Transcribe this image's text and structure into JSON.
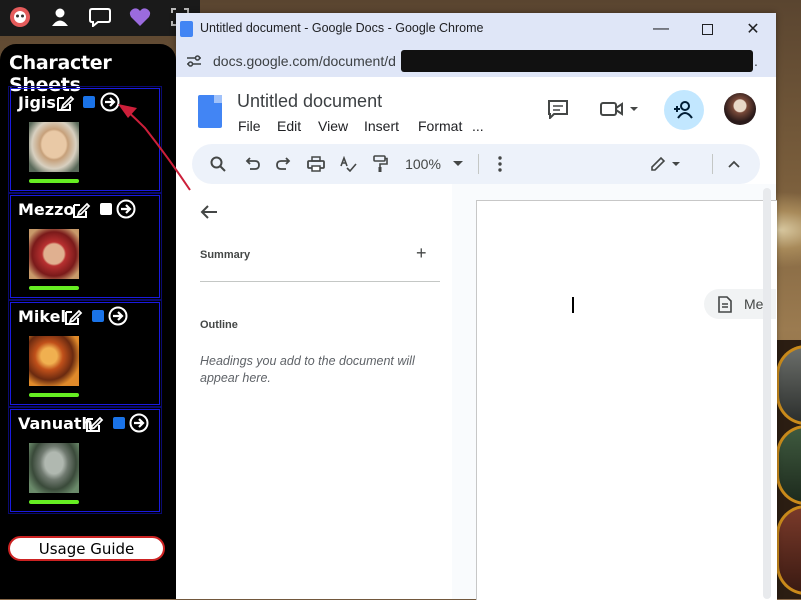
{
  "top_bar": {
    "icons": [
      "helmet-icon",
      "person-icon",
      "chat-icon",
      "heart-icon",
      "camera-icon"
    ]
  },
  "sidebar": {
    "title": "Character Sheets",
    "characters": [
      {
        "name": "Jigis",
        "checked": true,
        "hp_fraction": 1.0
      },
      {
        "name": "Mezzo",
        "checked": false,
        "hp_fraction": 1.0
      },
      {
        "name": "Mikel",
        "checked": true,
        "hp_fraction": 1.0
      },
      {
        "name": "Vanuath",
        "checked": true,
        "hp_fraction": 1.0
      }
    ],
    "usage_guide_label": "Usage Guide"
  },
  "browser": {
    "window_title": "Untitled document - Google Docs - Google Chrome",
    "url": "docs.google.com/document/d",
    "url_tail": "."
  },
  "docs": {
    "doc_title": "Untitled document",
    "menu": [
      "File",
      "Edit",
      "View",
      "Insert",
      "Format",
      "..."
    ],
    "zoom": "100%",
    "summary_label": "Summary",
    "outline_label": "Outline",
    "outline_hint": "Headings you add to the document will appear here.",
    "meet_chip_text": "Me"
  },
  "colors": {
    "accent_blue": "#1a73e8",
    "hp_green": "#66ee22",
    "card_border": "#1a1ae0",
    "annotation_red": "#cc1f3a"
  }
}
